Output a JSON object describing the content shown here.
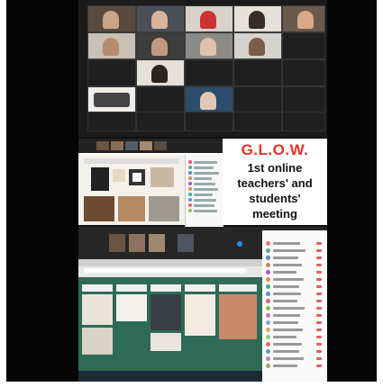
{
  "poster": {
    "title": "G.L.O.W.",
    "line1": "1st online",
    "line2": "teachers' and",
    "line3": "students'",
    "line4": "meeting"
  },
  "colors": {
    "title_red": "#e8302a",
    "zoom_dark": "#1b1b1b",
    "board_green": "#2f6a57"
  }
}
